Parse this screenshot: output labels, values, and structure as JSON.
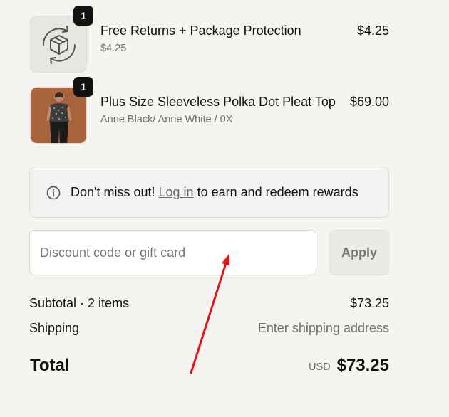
{
  "items": [
    {
      "name": "Free Returns + Package Protection",
      "subtitle": "$4.25",
      "price": "$4.25",
      "quantity": "1",
      "icon": "package-protection-icon"
    },
    {
      "name": "Plus Size Sleeveless Polka Dot Pleat Top",
      "subtitle": "Anne Black/ Anne White / 0X",
      "price": "$69.00",
      "quantity": "1",
      "icon": "product-photo"
    }
  ],
  "rewards": {
    "prefix": "Don't miss out!",
    "link": "Log in",
    "suffix": "to earn and redeem rewards",
    "icon": "info-icon"
  },
  "discount": {
    "placeholder": "Discount code or gift card",
    "value": "",
    "apply_label": "Apply"
  },
  "summary": {
    "subtotal_label": "Subtotal · 2 items",
    "subtotal_value": "$73.25",
    "shipping_label": "Shipping",
    "shipping_value": "Enter shipping address",
    "total_label": "Total",
    "currency": "USD",
    "total_value": "$73.25"
  },
  "colors": {
    "background": "#f5f4f1",
    "annotation_arrow": "#e0161b",
    "badge": "#111111"
  }
}
